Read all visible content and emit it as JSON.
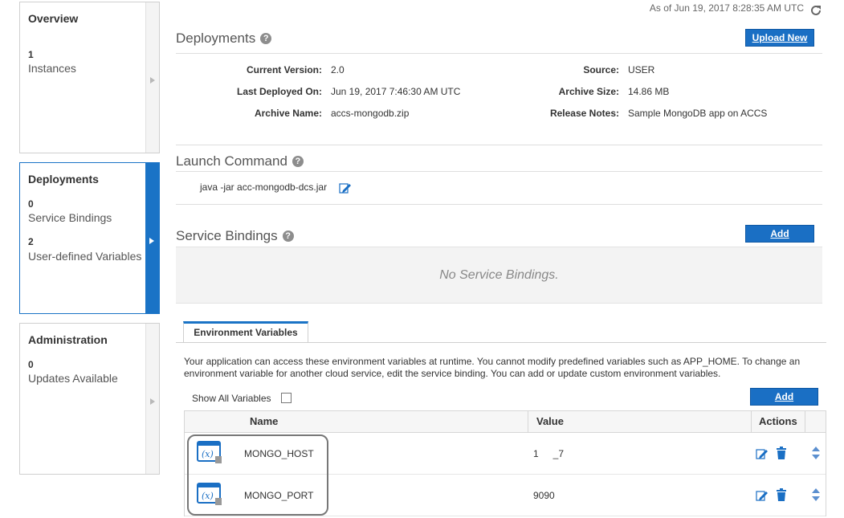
{
  "status": {
    "as_of": "As of Jun 19, 2017 8:28:35 AM UTC"
  },
  "nav": {
    "overview": {
      "title": "Overview",
      "count": "1",
      "label": "Instances"
    },
    "deployments": {
      "title": "Deployments",
      "count1": "0",
      "label1": "Service Bindings",
      "count2": "2",
      "label2": "User-defined Variables"
    },
    "administration": {
      "title": "Administration",
      "count": "0",
      "label": "Updates Available"
    }
  },
  "deployments": {
    "title": "Deployments",
    "upload_label": "Upload New",
    "current_version_label": "Current Version:",
    "current_version": "2.0",
    "last_deployed_label": "Last Deployed On:",
    "last_deployed": "Jun 19, 2017 7:46:30 AM UTC",
    "archive_name_label": "Archive Name:",
    "archive_name": "accs-mongodb.zip",
    "source_label": "Source:",
    "source": "USER",
    "archive_size_label": "Archive Size:",
    "archive_size": "14.86 MB",
    "release_notes_label": "Release Notes:",
    "release_notes": "Sample MongoDB app on ACCS"
  },
  "launch": {
    "title": "Launch Command",
    "command": "java -jar acc-mongodb-dcs.jar"
  },
  "bindings": {
    "title": "Service Bindings",
    "add_label": "Add",
    "empty_text": "No Service Bindings."
  },
  "env": {
    "tab_label": "Environment Variables",
    "description": "Your application can access these environment variables at runtime. You cannot modify predefined variables such as APP_HOME. To change an environment variable for another cloud service, edit the service binding. You can add or update custom environment variables.",
    "show_all_label": "Show All Variables",
    "show_all_checked": false,
    "add_label": "Add",
    "columns": {
      "name": "Name",
      "value": "Value",
      "actions": "Actions"
    },
    "rows": [
      {
        "name": "MONGO_HOST",
        "value": "1         _7"
      },
      {
        "name": "MONGO_PORT",
        "value": "9090"
      }
    ]
  },
  "colors": {
    "accent": "#1a73c6",
    "button": "#1a6fc4"
  }
}
